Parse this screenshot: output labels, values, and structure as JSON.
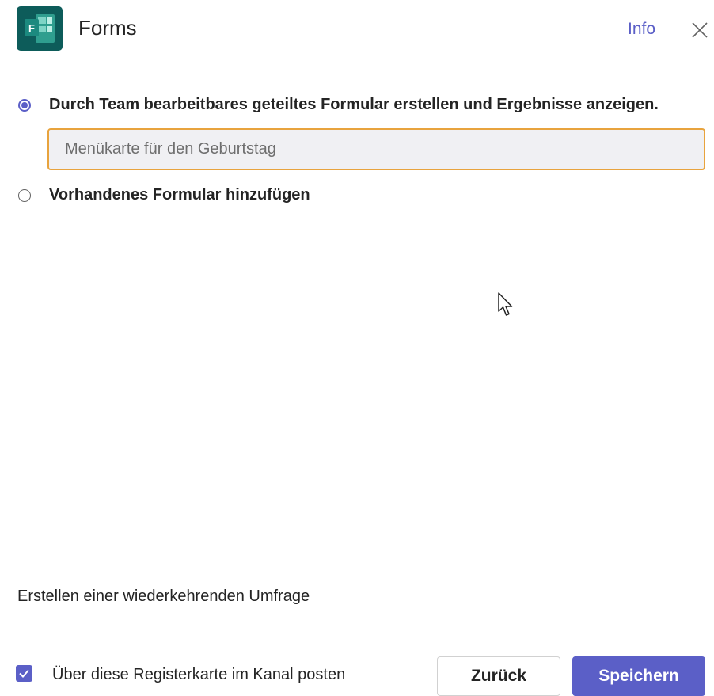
{
  "header": {
    "title": "Forms",
    "info_label": "Info",
    "app_icon": "forms-app-icon",
    "close_icon": "close-icon",
    "app_icon_letter": "F"
  },
  "options": [
    {
      "label": "Durch Team bearbeitbares geteiltes Formular erstellen und Ergebnisse anzeigen.",
      "selected": true
    },
    {
      "label": "Vorhandenes Formular hinzufügen",
      "selected": false
    }
  ],
  "form_name": {
    "value": "",
    "placeholder": "Menükarte für den Geburtstag"
  },
  "recurring_label": "Erstellen einer wiederkehrenden Umfrage",
  "footer": {
    "post_checkbox_label": "Über diese Registerkarte im Kanal posten",
    "post_checkbox_checked": true,
    "back_label": "Zurück",
    "save_label": "Speichern"
  },
  "colors": {
    "accent": "#5b5fc7",
    "input_focus_border": "#e8a33d",
    "forms_icon": "#0f6b67"
  }
}
